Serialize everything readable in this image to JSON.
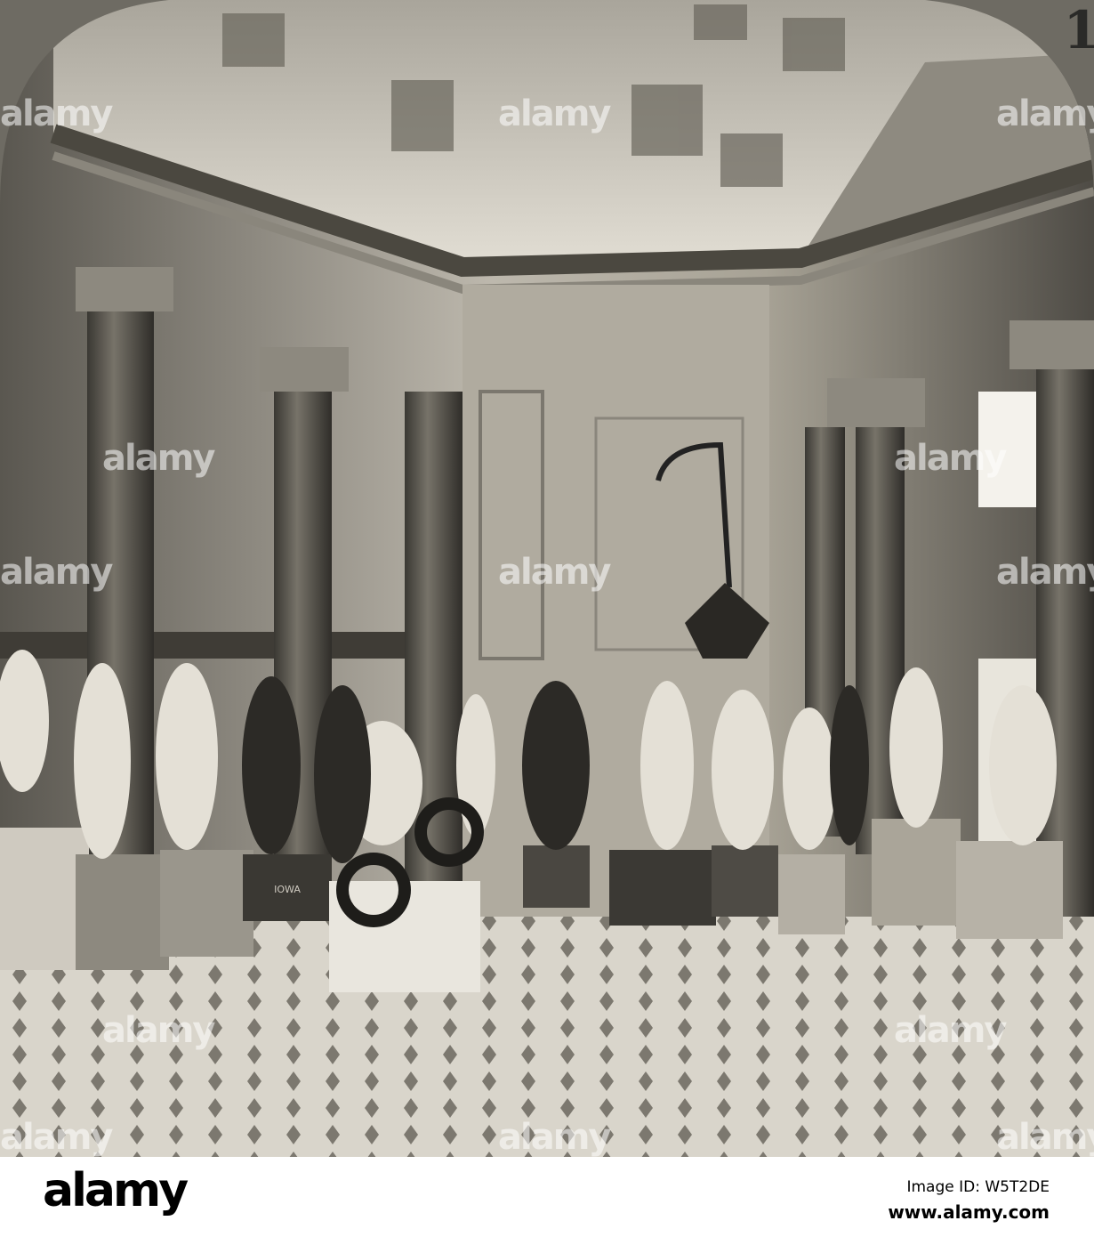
{
  "photo": {
    "card_number": "1",
    "pedestal_inscription": "IOWA"
  },
  "watermark": {
    "text": "alamy"
  },
  "footer": {
    "logo": "alamy",
    "image_id": "Image ID: W5T2DE",
    "website": "www.alamy.com"
  }
}
